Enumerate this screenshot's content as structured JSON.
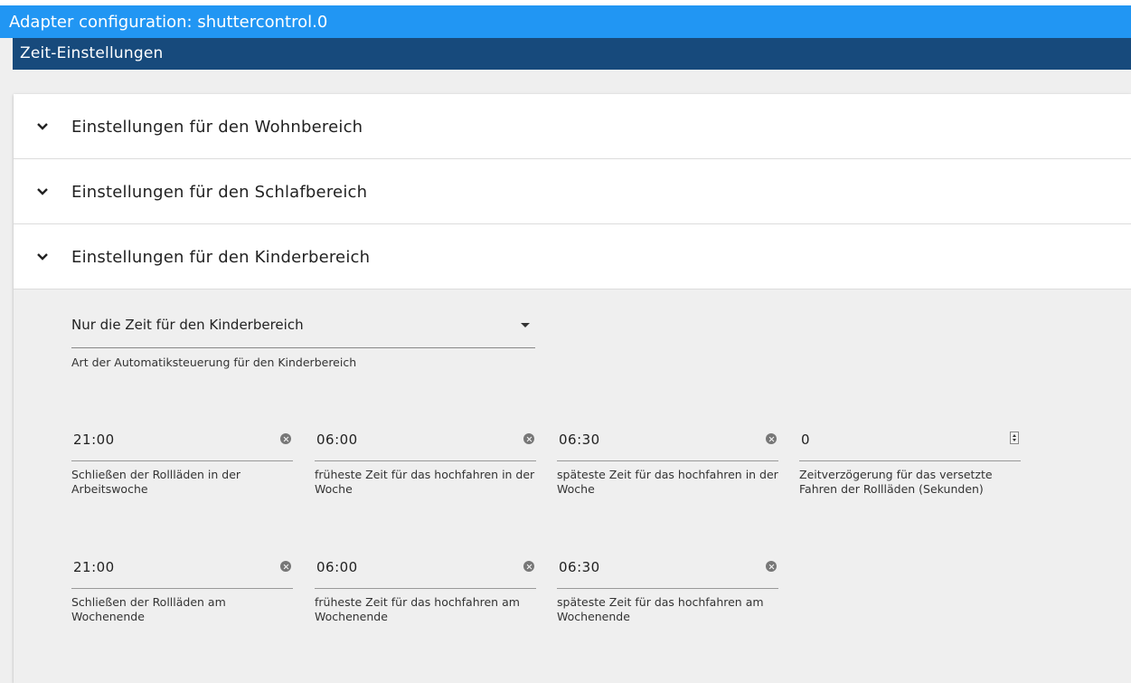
{
  "window": {
    "title": "Adapter configuration: shuttercontrol.0"
  },
  "tab": {
    "label": "Zeit-Einstellungen"
  },
  "accordion": [
    {
      "label": "Einstellungen für den Wohnbereich"
    },
    {
      "label": "Einstellungen für den Schlafbereich"
    },
    {
      "label": "Einstellungen für den Kinderbereich"
    }
  ],
  "kinder": {
    "mode_select": {
      "value": "Nur die Zeit für den Kinderbereich",
      "help": "Art der Automatiksteuerung für den Kinderbereich"
    },
    "fields": [
      {
        "value": "21:00",
        "help": "Schließen der Rollläden in der Arbeitswoche"
      },
      {
        "value": "06:00",
        "help": "früheste Zeit für das hochfahren in der Woche"
      },
      {
        "value": "06:30",
        "help": "späteste Zeit für das hochfahren in der Woche"
      },
      {
        "value": "0",
        "help": "Zeitverzögerung für das versetzte Fahren der Rollläden (Sekunden)"
      },
      {
        "value": "21:00",
        "help": "Schließen der Rollläden am Wochenende"
      },
      {
        "value": "06:00",
        "help": "früheste Zeit für das hochfahren am Wochenende"
      },
      {
        "value": "06:30",
        "help": "späteste Zeit für das hochfahren am Wochenende"
      }
    ]
  },
  "icons": {
    "expand": "chevron-down-icon",
    "clear": "clear-circle-icon",
    "spinner": "number-spinner-icon",
    "dropdown": "dropdown-arrow-icon"
  },
  "colors": {
    "title_bar": "#2196f3",
    "tab_bar": "#174a7c",
    "background": "#efefef"
  }
}
